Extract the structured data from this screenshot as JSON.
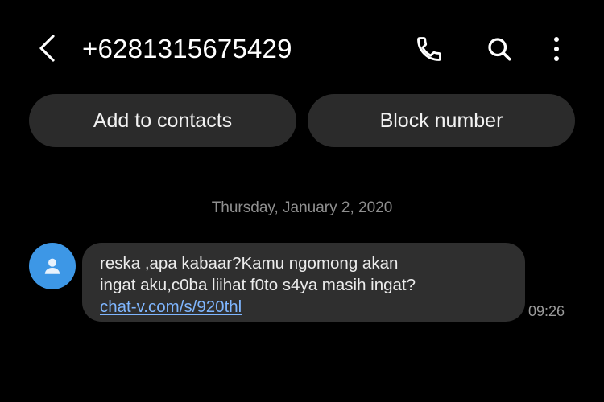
{
  "header": {
    "title": "+6281315675429",
    "icons": {
      "back": "chevron-left-icon",
      "call": "phone-icon",
      "search": "search-icon",
      "more": "more-vertical-icon"
    }
  },
  "actions": {
    "add_contacts_label": "Add to contacts",
    "block_number_label": "Block number"
  },
  "conversation": {
    "date": "Thursday, January 2, 2020",
    "message": {
      "avatar_icon": "person-icon",
      "line1": "reska ,apa kabaar?Kamu ngomong akan",
      "line2": "ingat aku,c0ba liihat f0to s4ya masih ingat?",
      "link": "chat-v.com/s/920thl",
      "time": "09:26"
    }
  },
  "colors": {
    "background": "#000000",
    "button_bg": "#2b2b2b",
    "bubble_bg": "#2f2f2f",
    "avatar_bg": "#3d97e6",
    "link": "#7fb6ff",
    "muted_text": "#8f8f8f"
  }
}
